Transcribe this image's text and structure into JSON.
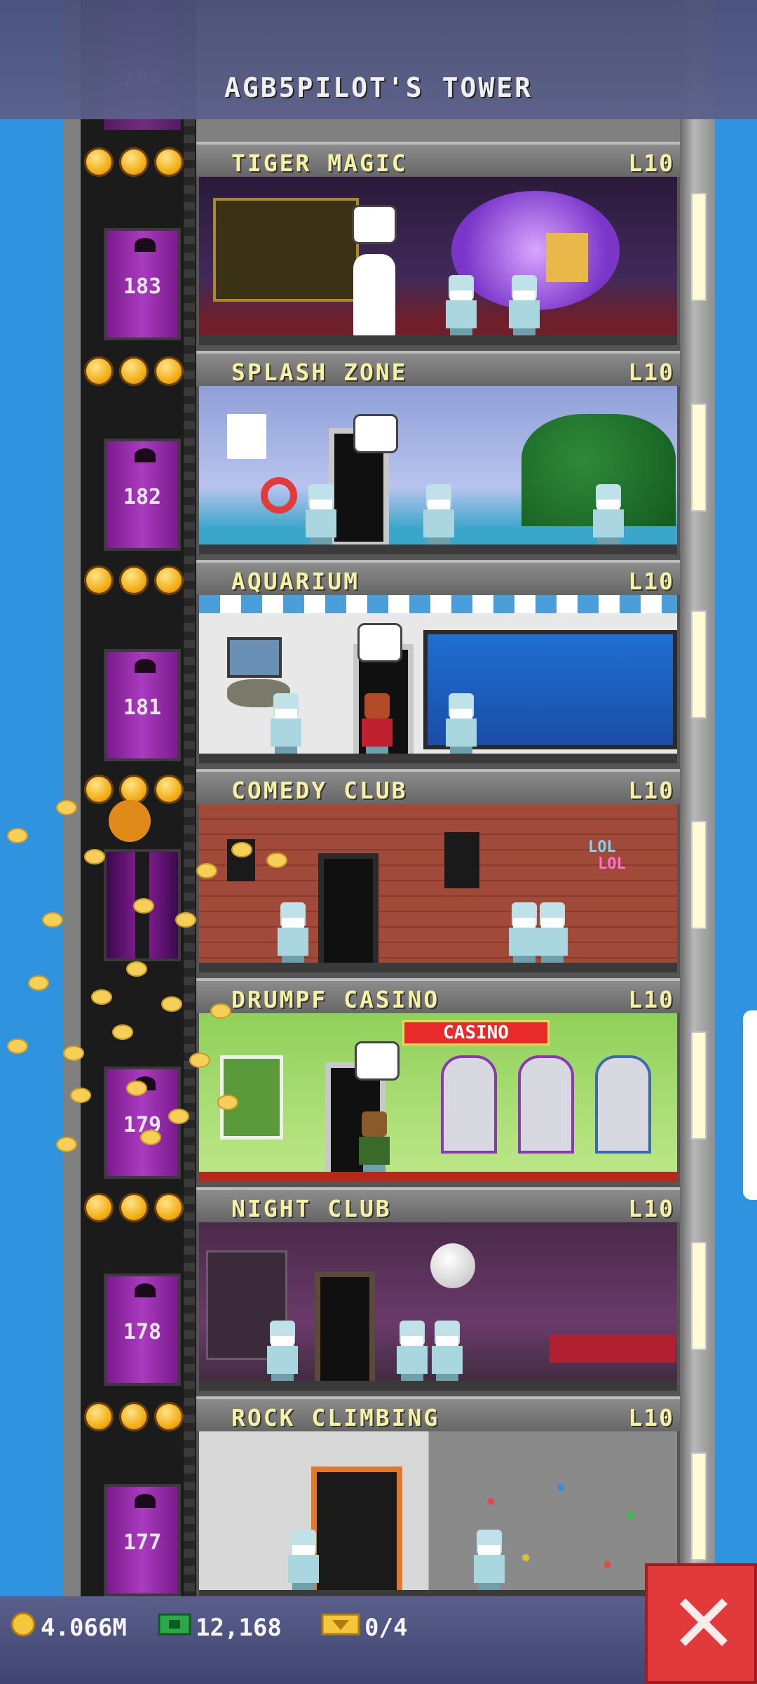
{
  "tower": {
    "title": "AGB5PILOT'S TOWER",
    "top_floor_number": "184"
  },
  "floors": [
    {
      "name": "TIGER MAGIC",
      "level": "L10",
      "number": "183"
    },
    {
      "name": "SPLASH ZONE",
      "level": "L10",
      "number": "182"
    },
    {
      "name": "AQUARIUM",
      "level": "L10",
      "number": "181"
    },
    {
      "name": "COMEDY CLUB",
      "level": "L10",
      "number": ""
    },
    {
      "name": "DRUMPF CASINO",
      "level": "L10",
      "number": "179"
    },
    {
      "name": "NIGHT CLUB",
      "level": "L10",
      "number": "178"
    },
    {
      "name": "ROCK CLIMBING",
      "level": "L10",
      "number": "177"
    }
  ],
  "rooms": {
    "casino_sign": "CASINO",
    "comedy_sign_1": "LOL",
    "comedy_sign_2": "LOL"
  },
  "stats": {
    "coins": "4.066M",
    "bux": "12,168",
    "tickets": "0/4"
  },
  "icons": {
    "coin": "coin-icon",
    "bux": "bux-icon",
    "ticket": "ticket-icon",
    "close": "close-icon",
    "star": "star-icon"
  },
  "colors": {
    "sky": "#2f93e0",
    "elevator": "#a93bbf",
    "floor_label": "#f5f2a5",
    "close_button": "#e23a3a"
  }
}
